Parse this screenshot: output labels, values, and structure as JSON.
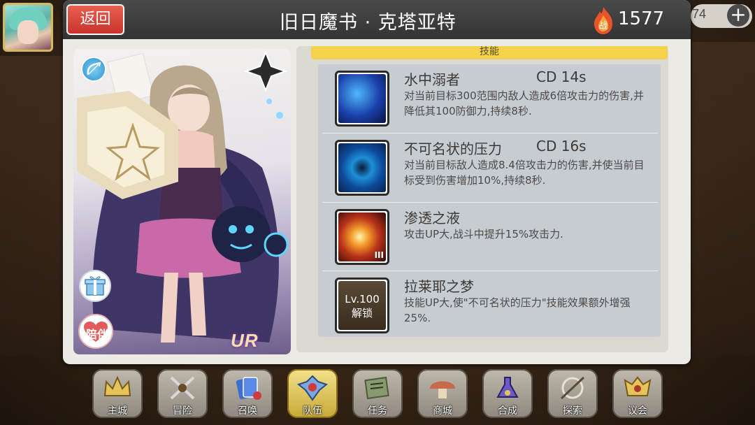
{
  "header": {
    "back_label": "返回",
    "title": "旧日魔书 · 克塔亚特",
    "power_badge": "战",
    "power_value": "1577"
  },
  "currency": {
    "value": "74",
    "plus_label": "+"
  },
  "card": {
    "rarity": "UR",
    "companion_label": "陪伴",
    "class_icon": "bow-icon",
    "gift_icon": "gift-icon"
  },
  "skills": {
    "header": "技能",
    "items": [
      {
        "name": "水中溺者",
        "cd": "CD  14s",
        "desc": "对当前目标300范围内敌人造成6倍攻击力的伤害,并降低其100防御力,持续8秒.",
        "icon": "tentacle-skill-icon"
      },
      {
        "name": "不可名状的压力",
        "cd": "CD  16s",
        "desc": "对当前目标敌人造成8.4倍攻击力的伤害,并使当前目标受到伤害增加10%,持续8秒.",
        "icon": "vortex-skill-icon"
      },
      {
        "name": "渗透之液",
        "cd": "",
        "desc": "攻击UP大,战斗中提升15%攻击力.",
        "icon": "slash-skill-icon",
        "level_mark": "III"
      },
      {
        "name": "拉莱耶之梦",
        "cd": "",
        "desc": "技能UP大,使\"不可名状的压力\"技能效果额外增强25%.",
        "icon": "locked-skill-icon",
        "lock_line1": "Lv.100",
        "lock_line2": "解锁"
      }
    ]
  },
  "nav": {
    "items": [
      {
        "label": "主城",
        "icon": "crown-icon"
      },
      {
        "label": "冒险",
        "icon": "crossed-swords-icon"
      },
      {
        "label": "召唤",
        "icon": "cards-icon"
      },
      {
        "label": "队伍",
        "icon": "team-emblem-icon",
        "active": true
      },
      {
        "label": "任务",
        "icon": "scroll-icon"
      },
      {
        "label": "商城",
        "icon": "mushroom-shop-icon"
      },
      {
        "label": "合成",
        "icon": "alchemy-icon"
      },
      {
        "label": "探索",
        "icon": "compass-icon"
      },
      {
        "label": "议会",
        "icon": "council-crest-icon"
      }
    ]
  },
  "colors": {
    "accent_yellow": "#f5d24c",
    "back_red": "#d9473b",
    "panel": "#eceae5"
  }
}
